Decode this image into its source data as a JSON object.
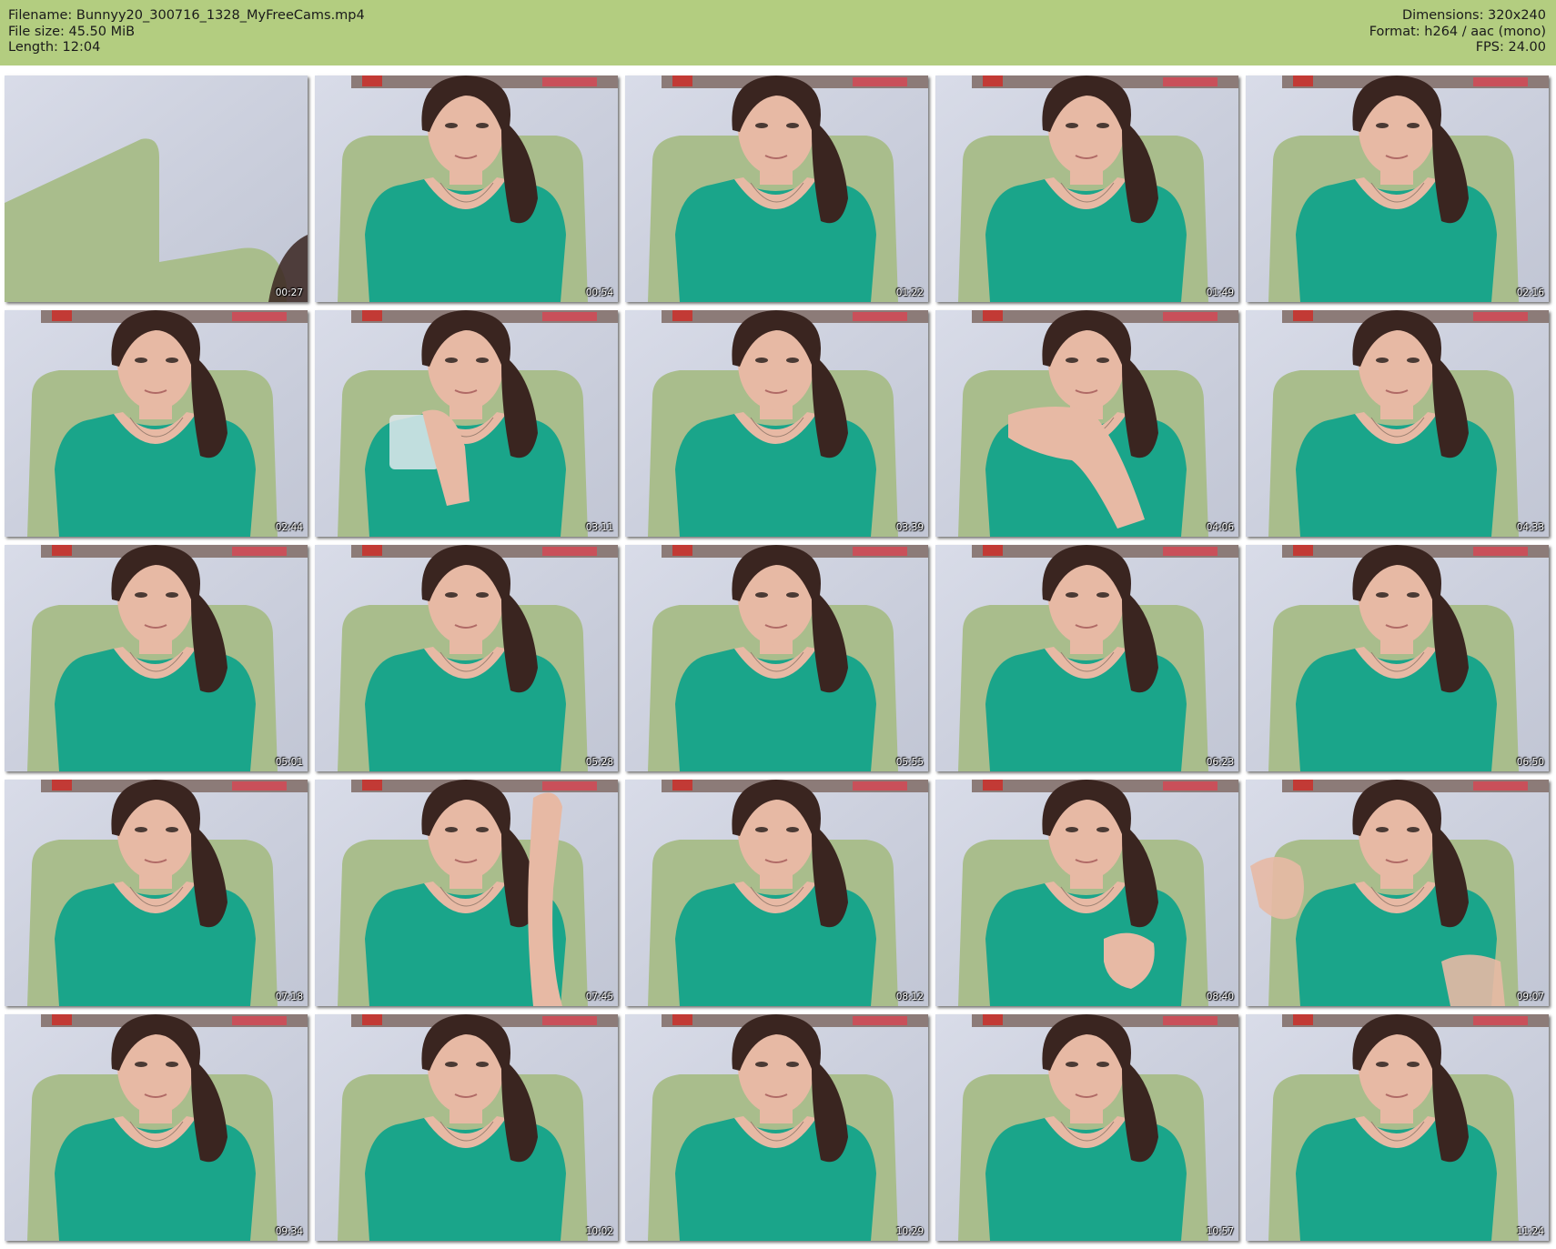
{
  "header": {
    "filename_line": "Filename: Bunnyy20_300716_1328_MyFreeCams.mp4",
    "filesize_line": "File size: 45.50 MiB",
    "length_line": "Length: 12:04",
    "dimensions_line": "Dimensions: 320x240",
    "format_line": "Format: h264 / aac (mono)",
    "fps_line": "FPS: 24.00"
  },
  "colors": {
    "header_bg": "#b3cd80",
    "wall": "#cfd3e0",
    "chair": "#a9bd8c",
    "shirt": "#1aa58a",
    "hair": "#3a2520",
    "skin": "#e7b9a4"
  },
  "thumbnails": [
    {
      "timestamp": "00:27",
      "scene": "empty-chair"
    },
    {
      "timestamp": "00:54",
      "scene": "person"
    },
    {
      "timestamp": "01:22",
      "scene": "person"
    },
    {
      "timestamp": "01:49",
      "scene": "person"
    },
    {
      "timestamp": "02:16",
      "scene": "person"
    },
    {
      "timestamp": "02:44",
      "scene": "person"
    },
    {
      "timestamp": "03:11",
      "scene": "person-drinking"
    },
    {
      "timestamp": "03:39",
      "scene": "person"
    },
    {
      "timestamp": "04:06",
      "scene": "person-hand-face"
    },
    {
      "timestamp": "04:33",
      "scene": "person"
    },
    {
      "timestamp": "05:01",
      "scene": "person"
    },
    {
      "timestamp": "05:28",
      "scene": "person"
    },
    {
      "timestamp": "05:55",
      "scene": "person"
    },
    {
      "timestamp": "06:23",
      "scene": "person"
    },
    {
      "timestamp": "06:50",
      "scene": "person"
    },
    {
      "timestamp": "07:18",
      "scene": "person"
    },
    {
      "timestamp": "07:45",
      "scene": "person-hand-hair"
    },
    {
      "timestamp": "08:12",
      "scene": "person"
    },
    {
      "timestamp": "08:40",
      "scene": "person-hand-chest"
    },
    {
      "timestamp": "09:07",
      "scene": "person-waving"
    },
    {
      "timestamp": "09:34",
      "scene": "person"
    },
    {
      "timestamp": "10:02",
      "scene": "person"
    },
    {
      "timestamp": "10:29",
      "scene": "person"
    },
    {
      "timestamp": "10:57",
      "scene": "person"
    },
    {
      "timestamp": "11:24",
      "scene": "person"
    }
  ]
}
